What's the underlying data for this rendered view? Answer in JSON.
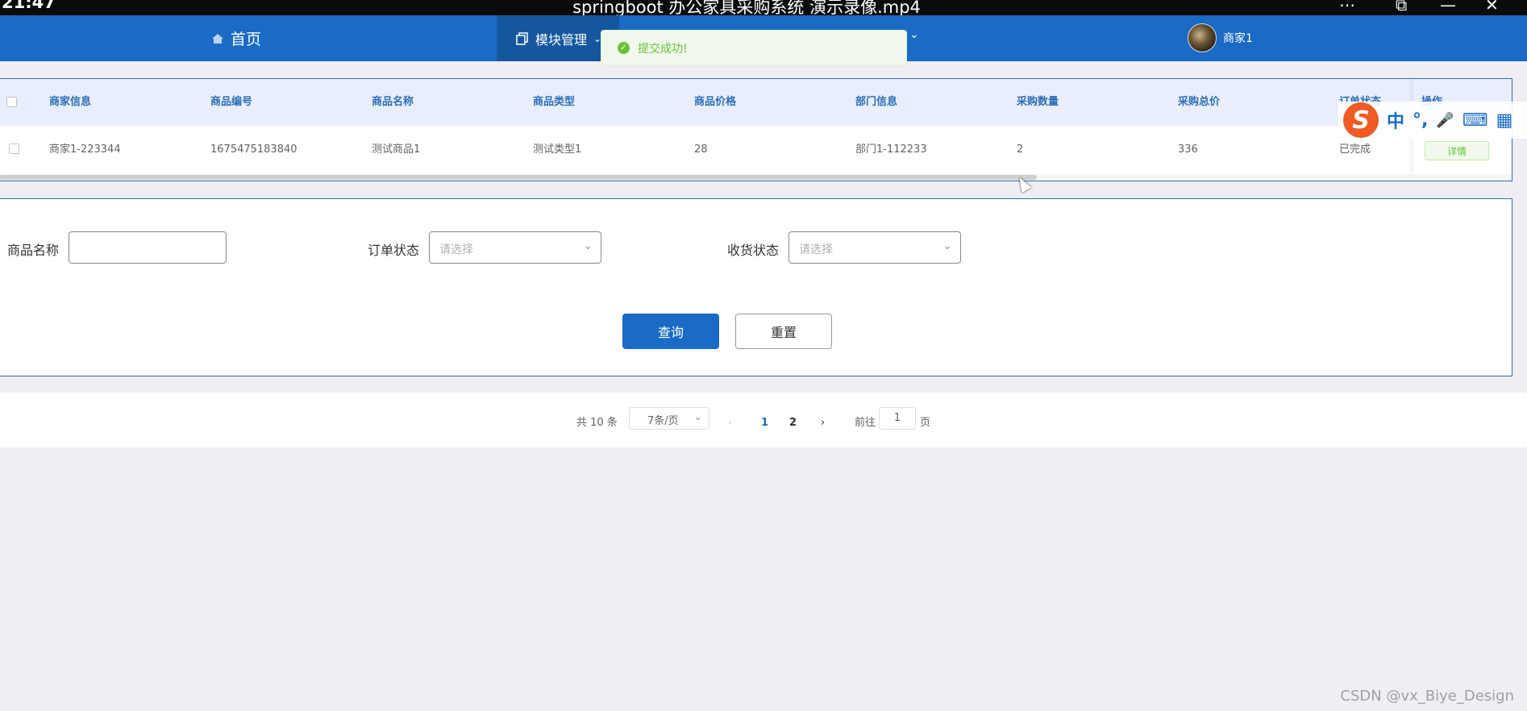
{
  "video": {
    "time": "21:47",
    "title": "springboot 办公家具采购系统 演示录像.mp4"
  },
  "nav": {
    "home_label": "首页",
    "home_icon": "home-icon",
    "module_label": "模块管理",
    "user_name": "商家1"
  },
  "toast": {
    "message": "提交成功!",
    "icon": "check-circle-icon",
    "color": "#67c23a"
  },
  "table": {
    "columns": [
      "商家信息",
      "商品编号",
      "商品名称",
      "商品类型",
      "商品价格",
      "部门信息",
      "采购数量",
      "采购总价",
      "订单状态",
      "操作"
    ],
    "rows": [
      {
        "merchant": "商家1-223344",
        "product_no": "1675475183840",
        "product_name": "测试商品1",
        "product_type": "测试类型1",
        "price": "28",
        "department": "部门1-112233",
        "quantity": "2",
        "total": "336",
        "status": "已完成",
        "action": "详情"
      }
    ]
  },
  "ime": {
    "items": [
      "中",
      "°,",
      "🎤",
      "⌨",
      "▦"
    ]
  },
  "search": {
    "product_name_label": "商品名称",
    "product_name_value": "",
    "order_status_label": "订单状态",
    "order_status_placeholder": "请选择",
    "receive_status_label": "收货状态",
    "receive_status_placeholder": "请选择",
    "query_button": "查询",
    "reset_button": "重置"
  },
  "pagination": {
    "total": "共 10 条",
    "page_size": "7条/页",
    "pages": [
      "1",
      "2"
    ],
    "current_page": "1",
    "goto_label": "前往",
    "goto_value": "1",
    "page_suffix": "页"
  },
  "watermark": "CSDN @vx_Biye_Design",
  "colors": {
    "primary": "#1a6bc6",
    "success": "#67c23a"
  }
}
